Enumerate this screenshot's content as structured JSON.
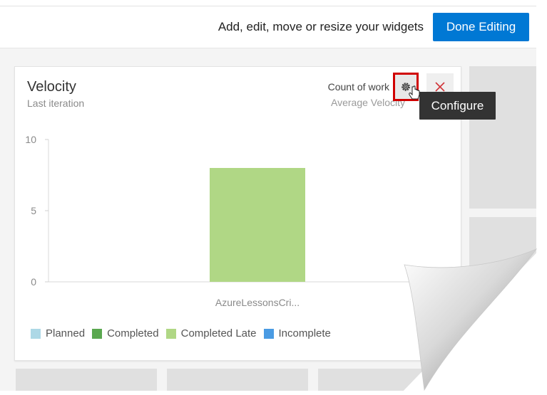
{
  "header": {
    "hint": "Add, edit, move or resize your widgets",
    "done_label": "Done Editing"
  },
  "widget": {
    "title": "Velocity",
    "subtitle": "Last iteration",
    "metric": "Count of work",
    "metric_secondary": "Average Velocity",
    "configure_tooltip": "Configure"
  },
  "icons": {
    "configure": "gear-icon",
    "remove": "close-icon",
    "pointer": "hand-cursor-icon"
  },
  "colors": {
    "primary": "#0078d4",
    "planned": "#add8e6",
    "completed": "#5aa84f",
    "completed_late": "#b0d785",
    "incomplete": "#4a9be3",
    "highlight": "#d00000"
  },
  "chart_data": {
    "type": "bar",
    "categories": [
      "AzureLessonsCri..."
    ],
    "series": [
      {
        "name": "Planned",
        "values": [
          0
        ]
      },
      {
        "name": "Completed",
        "values": [
          0
        ]
      },
      {
        "name": "Completed Late",
        "values": [
          8
        ]
      },
      {
        "name": "Incomplete",
        "values": [
          0
        ]
      }
    ],
    "yticks": [
      0,
      5,
      10
    ],
    "ylim": [
      0,
      10
    ],
    "legend": "bottom-left",
    "grid": false
  }
}
